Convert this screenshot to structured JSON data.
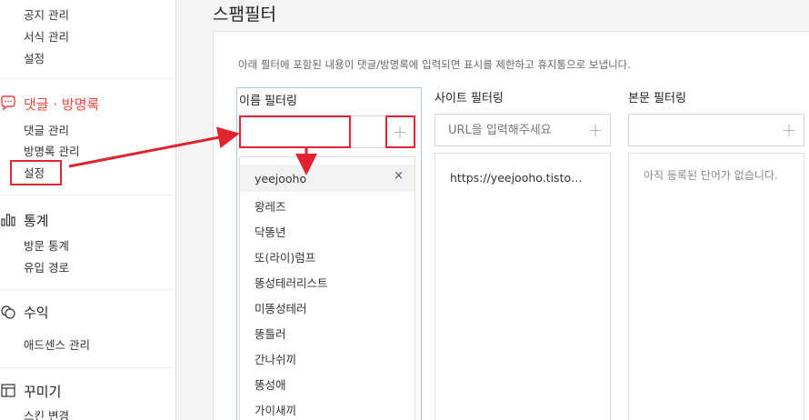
{
  "sidebar": {
    "notice_group": [
      {
        "label": "공지 관리"
      },
      {
        "label": "서식 관리"
      },
      {
        "label": "설정"
      }
    ],
    "comment_section": {
      "title": "댓글 · 방명록",
      "items": [
        {
          "label": "댓글 관리"
        },
        {
          "label": "방명록 관리"
        },
        {
          "label": "설정"
        }
      ]
    },
    "stats_section": {
      "title": "통계",
      "items": [
        {
          "label": "방문 통계"
        },
        {
          "label": "유입 경로"
        }
      ]
    },
    "revenue_section": {
      "title": "수익",
      "items": [
        {
          "label": "애드센스 관리"
        }
      ]
    },
    "design_section": {
      "title": "꾸미기",
      "items": [
        {
          "label": "스킨 변경"
        }
      ]
    }
  },
  "main": {
    "title": "스팸필터",
    "description": "아래 필터에 포함된 내용이 댓글/방명록에 입력되면 표시를 제한하고 휴지통으로 보냅니다.",
    "name_filter": {
      "title": "이름 필터링",
      "input_value": "",
      "add_symbol": "+",
      "remove_symbol": "×",
      "items": [
        "yeejooho",
        "왕레즈",
        "닥똥년",
        "또(라이)럼프",
        "똥성테러리스트",
        "미똥성테러",
        "똥틀러",
        "간나쉬끼",
        "똥성애",
        "가이새끼"
      ]
    },
    "site_filter": {
      "title": "사이트 필터링",
      "placeholder": "URL을 입력해주세요",
      "add_symbol": "+",
      "items": [
        "https://yeejooho.tisto…"
      ]
    },
    "body_filter": {
      "title": "본문 필터링",
      "add_symbol": "+",
      "empty_message": "아직 등록된 단어가 없습니다."
    }
  },
  "colors": {
    "accent_red": "#f0443e",
    "highlight_red": "#e0232f",
    "focus_blue": "#a9c6ea"
  },
  "icons": [
    "comment-icon",
    "chart-icon",
    "coin-icon",
    "brush-icon",
    "plus-icon",
    "close-icon",
    "arrow-annotation"
  ]
}
